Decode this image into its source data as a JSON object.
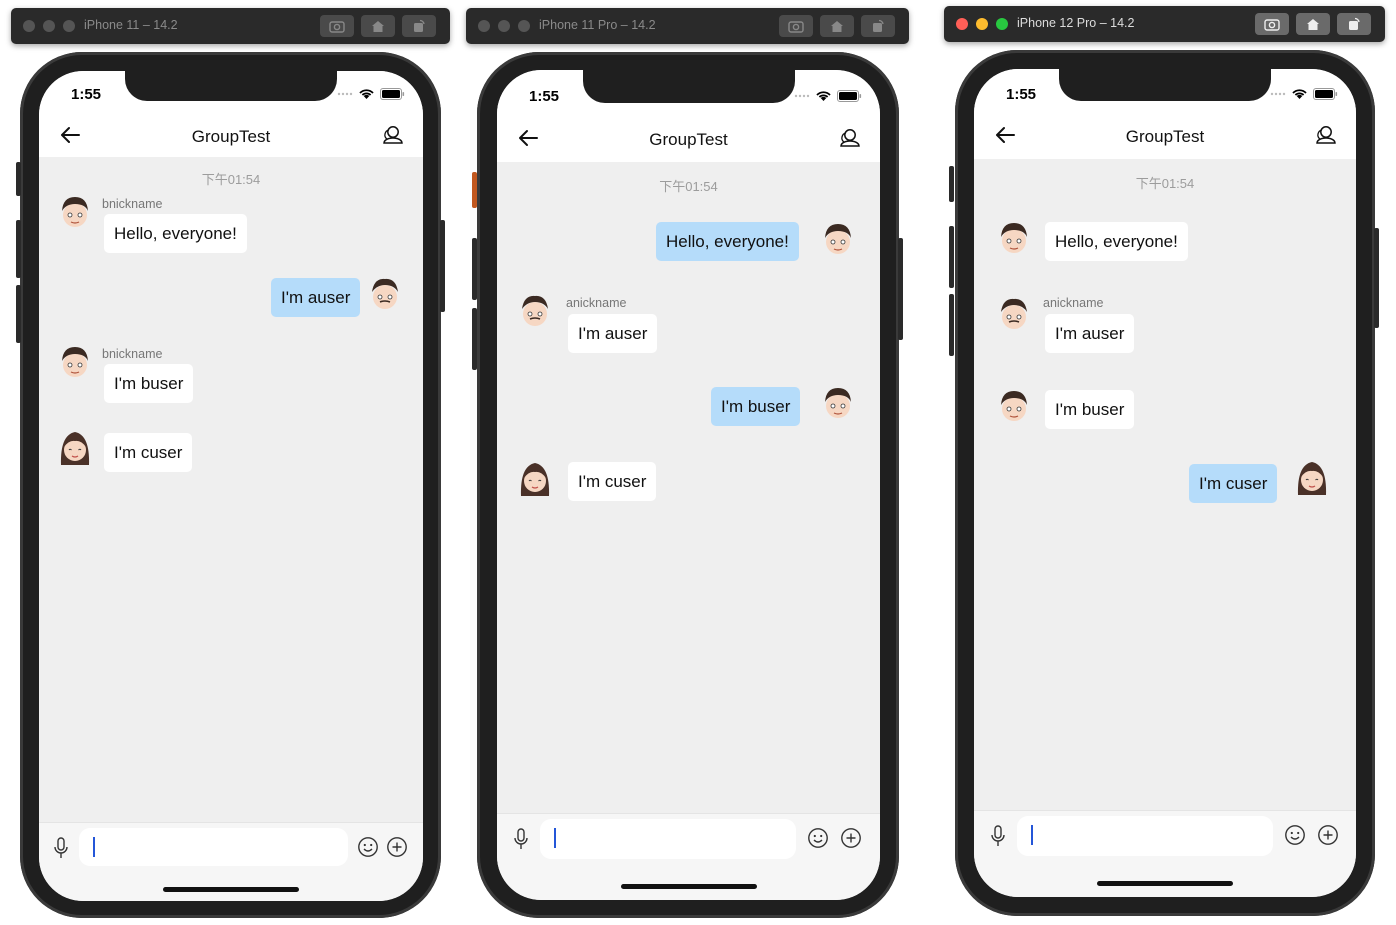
{
  "simulators": [
    {
      "window_title": "iPhone 11 – 14.2",
      "status_time": "1:55",
      "chat_title": "GroupTest",
      "timestamp": "下午01:54",
      "messages": [
        {
          "nickname": "bnickname",
          "text": "Hello, everyone!",
          "direction": "incoming",
          "avatar": "boy-avatar-icon"
        },
        {
          "nickname": "",
          "text": "I'm auser",
          "direction": "outgoing",
          "avatar": "man-avatar-icon"
        },
        {
          "nickname": "bnickname",
          "text": "I'm buser",
          "direction": "incoming",
          "avatar": "boy-avatar-icon"
        },
        {
          "nickname": "",
          "text": "I'm cuser",
          "direction": "incoming",
          "avatar": "girl-avatar-icon"
        }
      ]
    },
    {
      "window_title": "iPhone 11 Pro – 14.2",
      "status_time": "1:55",
      "chat_title": "GroupTest",
      "timestamp": "下午01:54",
      "messages": [
        {
          "nickname": "",
          "text": "Hello, everyone!",
          "direction": "outgoing",
          "avatar": "boy-avatar-icon"
        },
        {
          "nickname": "anickname",
          "text": "I'm auser",
          "direction": "incoming",
          "avatar": "man-avatar-icon"
        },
        {
          "nickname": "",
          "text": "I'm buser",
          "direction": "outgoing",
          "avatar": "boy-avatar-icon"
        },
        {
          "nickname": "",
          "text": "I'm cuser",
          "direction": "incoming",
          "avatar": "girl-avatar-icon"
        }
      ]
    },
    {
      "window_title": "iPhone 12 Pro – 14.2",
      "status_time": "1:55",
      "chat_title": "GroupTest",
      "timestamp": "下午01:54",
      "messages": [
        {
          "nickname": "",
          "text": "Hello, everyone!",
          "direction": "incoming",
          "avatar": "boy-avatar-icon"
        },
        {
          "nickname": "anickname",
          "text": "I'm auser",
          "direction": "incoming",
          "avatar": "man-avatar-icon"
        },
        {
          "nickname": "",
          "text": "I'm buser",
          "direction": "incoming",
          "avatar": "boy-avatar-icon"
        },
        {
          "nickname": "",
          "text": "I'm cuser",
          "direction": "outgoing",
          "avatar": "girl-avatar-icon"
        }
      ]
    }
  ],
  "colors": {
    "outgoing_bubble": "#b5dcfa",
    "incoming_bubble": "#ffffff",
    "chat_background": "#efefef",
    "caret": "#2456d8"
  }
}
